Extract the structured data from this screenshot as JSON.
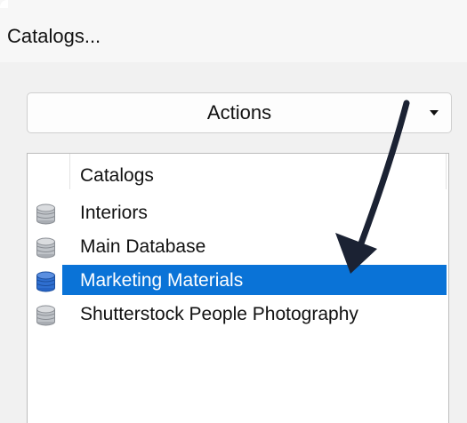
{
  "window": {
    "title": "Catalogs..."
  },
  "actions": {
    "label": "Actions"
  },
  "tree": {
    "header": "Catalogs",
    "items": [
      {
        "label": "Interiors",
        "icon": "database-icon",
        "selected": false
      },
      {
        "label": "Main Database",
        "icon": "database-icon",
        "selected": false
      },
      {
        "label": "Marketing Materials",
        "icon": "database-icon",
        "selected": true
      },
      {
        "label": "Shutterstock People Photography",
        "icon": "database-icon",
        "selected": false
      }
    ]
  },
  "colors": {
    "selection": "#0a73d7",
    "arrow": "#1b2233",
    "db_icon_gray": "#b8bcc2",
    "db_icon_blue": "#2f6fd0"
  }
}
